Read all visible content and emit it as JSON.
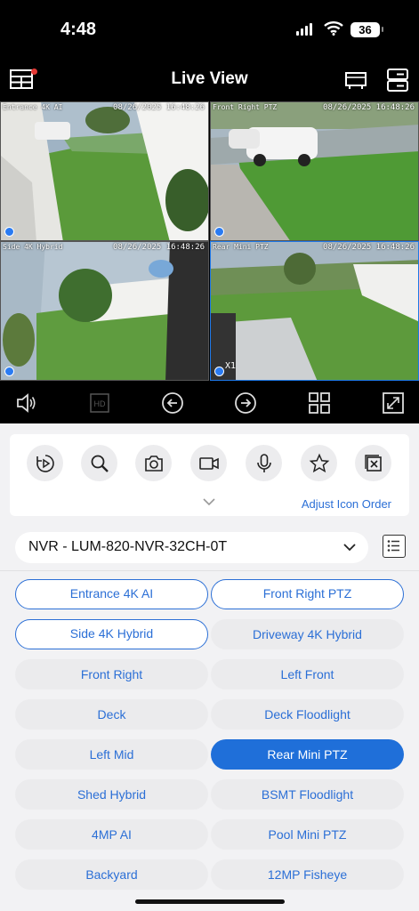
{
  "status": {
    "time": "4:48",
    "battery": "36"
  },
  "header": {
    "title": "Live View"
  },
  "cameras_view": [
    {
      "name": "Entrance 4K AI",
      "timestamp": "08/26/2025 16:48:26",
      "zoom": ""
    },
    {
      "name": "Front Right PTZ",
      "timestamp": "08/26/2025 16:48:26",
      "zoom": ""
    },
    {
      "name": "Side 4K Hybrid",
      "timestamp": "08/26/2025 16:48:26",
      "zoom": ""
    },
    {
      "name": "Rear Mini PTZ",
      "timestamp": "08/26/2025 16:48:26",
      "zoom": "X1"
    }
  ],
  "controls": [
    "speaker-icon",
    "hd-icon",
    "prev-icon",
    "next-icon",
    "grid-layout-icon",
    "fullscreen-icon"
  ],
  "hd_label": "HD",
  "tools": [
    "playback-icon",
    "search-icon",
    "snapshot-icon",
    "record-icon",
    "microphone-icon",
    "favorite-icon",
    "close-all-icon"
  ],
  "adjust_label": "Adjust Icon Order",
  "nvr": {
    "selected": "NVR - LUM-820-NVR-32CH-0T"
  },
  "camera_buttons": [
    {
      "label": "Entrance 4K AI",
      "state": "outline"
    },
    {
      "label": "Front Right PTZ",
      "state": "outline"
    },
    {
      "label": "Side 4K Hybrid",
      "state": "outline"
    },
    {
      "label": "Driveway 4K Hybrid",
      "state": "normal"
    },
    {
      "label": "Front Right",
      "state": "normal"
    },
    {
      "label": "Left Front",
      "state": "normal"
    },
    {
      "label": "Deck",
      "state": "normal"
    },
    {
      "label": "Deck Floodlight",
      "state": "normal"
    },
    {
      "label": "Left Mid",
      "state": "normal"
    },
    {
      "label": "Rear Mini PTZ",
      "state": "active"
    },
    {
      "label": "Shed Hybrid",
      "state": "normal"
    },
    {
      "label": "BSMT Floodlight",
      "state": "normal"
    },
    {
      "label": "4MP AI",
      "state": "normal"
    },
    {
      "label": "Pool Mini PTZ",
      "state": "normal"
    },
    {
      "label": "Backyard",
      "state": "normal"
    },
    {
      "label": "12MP Fisheye",
      "state": "normal"
    }
  ],
  "colors": {
    "accent": "#1f6fd9",
    "link": "#2b6fd6",
    "chip_bg": "#ebebed"
  }
}
